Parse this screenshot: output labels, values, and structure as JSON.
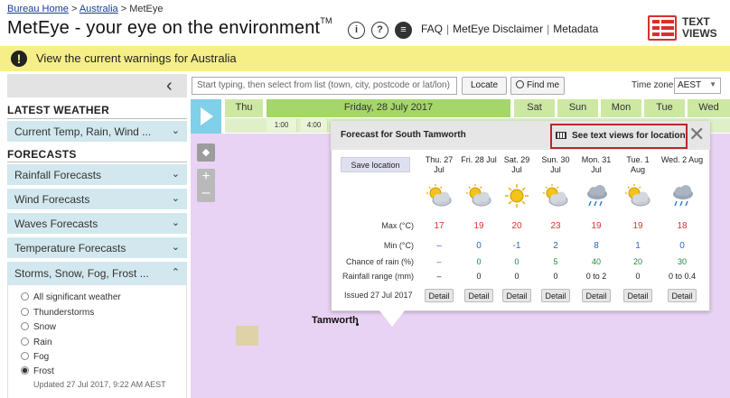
{
  "header": {
    "breadcrumb": [
      "Bureau Home",
      "Australia",
      "MetEye"
    ],
    "breadcrumb_sep": ">",
    "title": "MetEye",
    "subtitle": "your eye on the environment",
    "subtitle_prefix": "-",
    "tm": "TM",
    "links": [
      "FAQ",
      "MetEye Disclaimer",
      "Metadata"
    ],
    "text_views_logo": [
      "TEXT",
      "VIEWS"
    ]
  },
  "warning_bar": {
    "text": "View the current warnings for Australia",
    "icon": "exclamation-icon",
    "color": "#f6ef87"
  },
  "sidebar": {
    "latest_weather_heading": "LATEST WEATHER",
    "latest_item": "Current Temp, Rain, Wind ...",
    "forecasts_heading": "FORECASTS",
    "forecast_items": [
      "Rainfall Forecasts",
      "Wind Forecasts",
      "Waves Forecasts",
      "Temperature Forecasts"
    ],
    "open_item": "Storms, Snow, Fog, Frost ...",
    "options": [
      "All significant weather",
      "Thunderstorms",
      "Snow",
      "Rain",
      "Fog",
      "Frost"
    ],
    "selected_option": "Frost",
    "updated": "Updated 27 Jul 2017, 9:22 AM AEST"
  },
  "toolbar": {
    "search_placeholder": "Start typing, then select from list (town, city, postcode or lat/lon)",
    "locate_label": "Locate",
    "findme_label": "Find me",
    "timezone_label": "Time zone",
    "timezone_value": "AEST"
  },
  "timeline": {
    "days": [
      "Thu",
      "Friday, 28 July 2017",
      "Sat",
      "Sun",
      "Mon",
      "Tue",
      "Wed"
    ],
    "hours": [
      "1:00",
      "4:00"
    ]
  },
  "popup": {
    "title": "Forecast for South Tamworth",
    "text_views_button": "See text views for location",
    "save_location": "Save location",
    "days": [
      "Thu. 27 Jul",
      "Fri. 28 Jul",
      "Sat. 29 Jul",
      "Sun. 30 Jul",
      "Mon. 31 Jul",
      "Tue. 1 Aug",
      "Wed. 2 Aug"
    ],
    "icons": [
      "partly-cloudy-icon",
      "partly-cloudy-icon",
      "sunny-icon",
      "partly-cloudy-icon",
      "shower-icon",
      "partly-cloudy-icon",
      "shower-icon"
    ],
    "rows": {
      "max_label": "Max (°C)",
      "max": [
        "17",
        "19",
        "20",
        "23",
        "19",
        "19",
        "18"
      ],
      "min_label": "Min (°C)",
      "min": [
        "–",
        "0",
        "-1",
        "2",
        "8",
        "1",
        "0"
      ],
      "rain_chance_label": "Chance of rain (%)",
      "rain_chance": [
        "–",
        "0",
        "0",
        "5",
        "40",
        "20",
        "30"
      ],
      "rain_range_label": "Rainfall range (mm)",
      "rain_range": [
        "–",
        "0",
        "0",
        "0",
        "0 to 2",
        "0",
        "0 to 0.4"
      ]
    },
    "issued": "Issued 27 Jul 2017",
    "detail_label": "Detail"
  },
  "map": {
    "town": "Tamworth",
    "zoom_in": "+",
    "zoom_out": "–"
  }
}
